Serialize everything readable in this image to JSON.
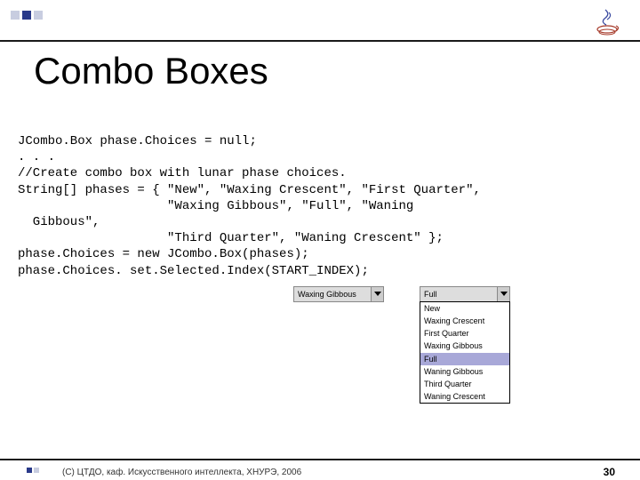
{
  "title": "Combo Boxes",
  "code": "JCombo.Box phase.Choices = null;\n. . .\n//Create combo box with lunar phase choices.\nString[] phases = { \"New\", \"Waxing Crescent\", \"First Quarter\",\n                    \"Waxing Gibbous\", \"Full\", \"Waning\n  Gibbous\",\n                    \"Third Quarter\", \"Waning Crescent\" };\nphase.Choices = new JCombo.Box(phases);\nphase.Choices. set.Selected.Index(START_INDEX);",
  "combo_closed": {
    "value": "Waxing Gibbous"
  },
  "combo_open": {
    "value": "Full",
    "items": [
      "New",
      "Waxing Crescent",
      "First Quarter",
      "Waxing Gibbous",
      "Full",
      "Waning Gibbous",
      "Third Quarter",
      "Waning Crescent"
    ],
    "selected_index": 4
  },
  "footer": "(С) ЦТДО, каф. Искусственного интеллекта, ХНУРЭ, 2006",
  "page": "30"
}
